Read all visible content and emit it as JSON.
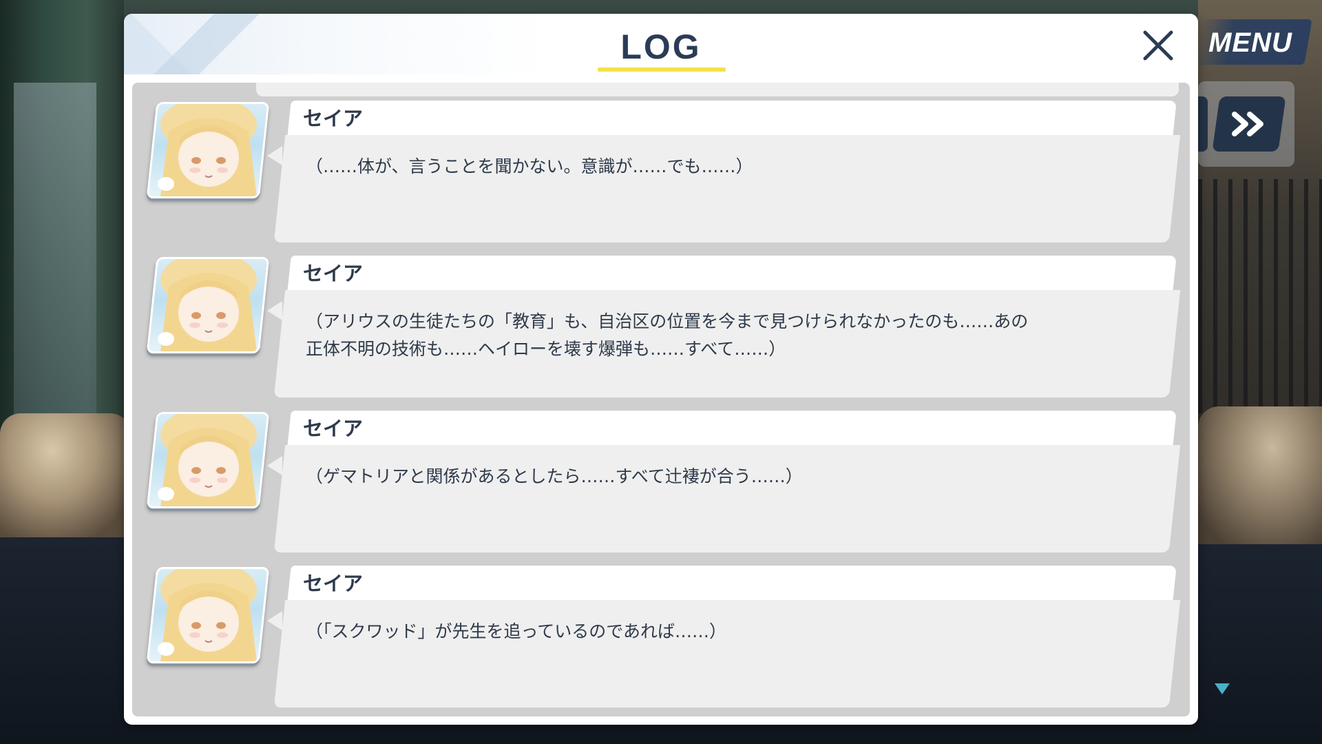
{
  "hud": {
    "menu_label": "MENU",
    "skip_icon": "fast-forward-icon",
    "scroll_icon": "triangle-down-icon"
  },
  "log": {
    "title": "LOG",
    "close_icon": "close-icon",
    "accent_color": "#f5e04a",
    "title_color": "#2a3c56",
    "entries": [
      {
        "speaker": "セイア",
        "text": "（……体が、言うことを聞かない。意識が……でも……）"
      },
      {
        "speaker": "セイア",
        "text": "（アリウスの生徒たちの「教育」も、自治区の位置を今まで見つけられなかったのも……あの\n正体不明の技術も……ヘイローを壊す爆弾も……すべて……）"
      },
      {
        "speaker": "セイア",
        "text": "（ゲマトリアと関係があるとしたら……すべて辻褄が合う……）"
      },
      {
        "speaker": "セイア",
        "text": "（「スクワッド」が先生を追っているのであれば……）"
      }
    ]
  }
}
